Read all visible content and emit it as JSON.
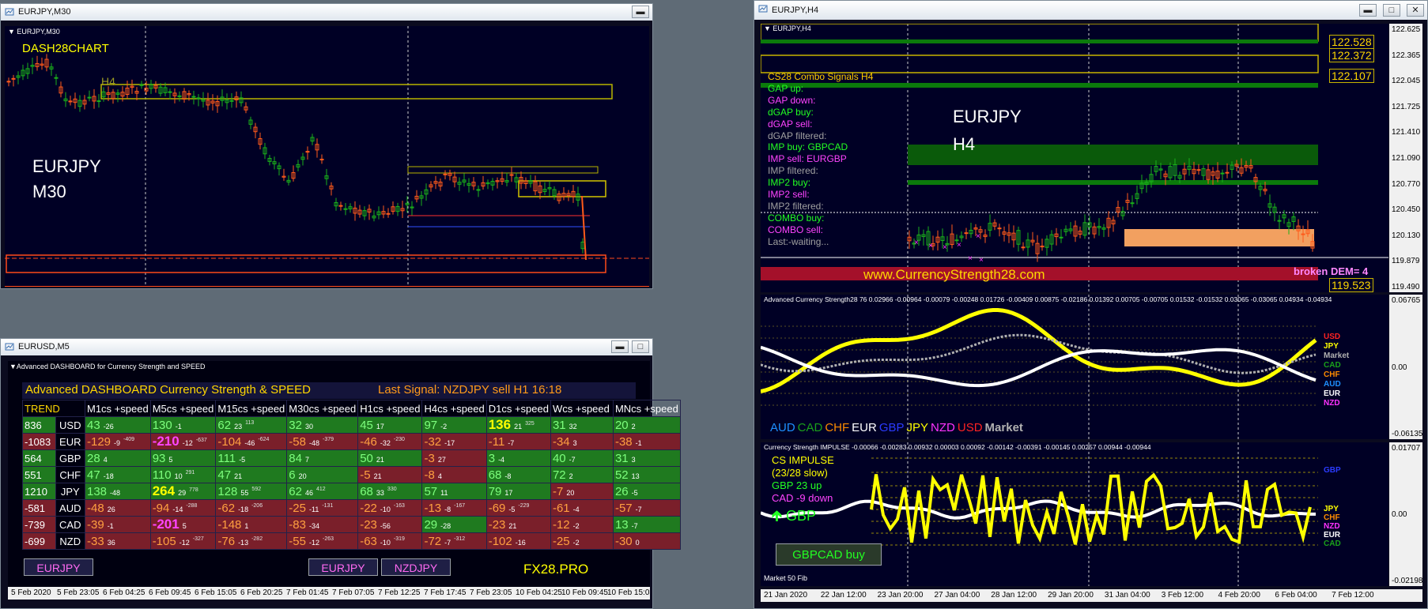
{
  "colors": {
    "bg": "#000025",
    "bull": "#1ab11a",
    "bear": "#ff5a1a",
    "yellow": "#ffff00",
    "magenta": "#ff44ff",
    "green_cell": "#1f8a1f",
    "red_cell": "#8a1f2a"
  },
  "win_eurjpy_m30": {
    "title": "EURJPY,M30",
    "chart_label": "EURJPY,M30",
    "brand": "DASH28CHART",
    "tf_tag": "H4",
    "symbol": "EURJPY",
    "timeframe": "M30"
  },
  "win_eurusd_m5": {
    "title": "EURUSD,M5",
    "chart_label": "Advanced DASHBOARD for Currency Strength and SPEED",
    "header_title": "Advanced  DASHBOARD Currency Strength & SPEED",
    "last_signal": "Last Signal: NZDJPY sell H1 16:18",
    "columns": [
      "TREND",
      "M1cs +speed",
      "M5cs +speed",
      "M15cs +speed",
      "M30cs +speed",
      "H1cs +speed",
      "H4cs +speed",
      "D1cs +speed",
      "Wcs +speed",
      "MNcs +speed"
    ],
    "rows": [
      {
        "trend": "836",
        "cur": "USD",
        "pos": true,
        "cells": [
          [
            "43",
            "-26",
            ""
          ],
          [
            "130",
            "-1",
            ""
          ],
          [
            "62",
            "23",
            "113"
          ],
          [
            "32",
            "30",
            ""
          ],
          [
            "45",
            "17",
            ""
          ],
          [
            "97",
            "-2",
            ""
          ],
          [
            "136",
            "21",
            "325"
          ],
          [
            "31",
            "32",
            ""
          ],
          [
            "20",
            "2",
            ""
          ]
        ]
      },
      {
        "trend": "-1083",
        "cur": "EUR",
        "pos": false,
        "cells": [
          [
            "-129",
            "-9",
            "-409"
          ],
          [
            "-210",
            "-12",
            "-637"
          ],
          [
            "-104",
            "-46",
            "-624"
          ],
          [
            "-58",
            "-48",
            "-379"
          ],
          [
            "-46",
            "-32",
            "-230"
          ],
          [
            "-32",
            "-17",
            ""
          ],
          [
            "-11",
            "-7",
            ""
          ],
          [
            "-34",
            "3",
            ""
          ],
          [
            "-38",
            "-1",
            ""
          ]
        ]
      },
      {
        "trend": "564",
        "cur": "GBP",
        "pos": true,
        "cells": [
          [
            "28",
            "4",
            ""
          ],
          [
            "93",
            "5",
            ""
          ],
          [
            "111",
            "-5",
            ""
          ],
          [
            "84",
            "7",
            ""
          ],
          [
            "50",
            "21",
            ""
          ],
          [
            "-3",
            "27",
            ""
          ],
          [
            "3",
            "-4",
            ""
          ],
          [
            "40",
            "-7",
            ""
          ],
          [
            "31",
            "3",
            ""
          ]
        ]
      },
      {
        "trend": "551",
        "cur": "CHF",
        "pos": true,
        "cells": [
          [
            "47",
            "-18",
            ""
          ],
          [
            "110",
            "10",
            "291"
          ],
          [
            "47",
            "21",
            ""
          ],
          [
            "6",
            "20",
            ""
          ],
          [
            "-5",
            "21",
            ""
          ],
          [
            "-8",
            "4",
            ""
          ],
          [
            "68",
            "-8",
            ""
          ],
          [
            "72",
            "2",
            ""
          ],
          [
            "52",
            "13",
            ""
          ]
        ]
      },
      {
        "trend": "1210",
        "cur": "JPY",
        "pos": true,
        "cells": [
          [
            "138",
            "-48",
            ""
          ],
          [
            "264",
            "29",
            "778"
          ],
          [
            "128",
            "55",
            "592"
          ],
          [
            "62",
            "46",
            "412"
          ],
          [
            "68",
            "33",
            "330"
          ],
          [
            "57",
            "11",
            ""
          ],
          [
            "79",
            "17",
            ""
          ],
          [
            "-7",
            "20",
            ""
          ],
          [
            "26",
            "-5",
            ""
          ]
        ]
      },
      {
        "trend": "-581",
        "cur": "AUD",
        "pos": false,
        "cells": [
          [
            "-48",
            "26",
            ""
          ],
          [
            "-94",
            "-14",
            "-288"
          ],
          [
            "-62",
            "-18",
            "-206"
          ],
          [
            "-25",
            "-11",
            "-131"
          ],
          [
            "-22",
            "-10",
            "-163"
          ],
          [
            "-13",
            "-8",
            "-167"
          ],
          [
            "-69",
            "-5",
            "-229"
          ],
          [
            "-61",
            "-4",
            ""
          ],
          [
            "-57",
            "-7",
            ""
          ]
        ]
      },
      {
        "trend": "-739",
        "cur": "CAD",
        "pos": false,
        "cells": [
          [
            "-39",
            "-1",
            ""
          ],
          [
            "-201",
            "5",
            ""
          ],
          [
            "-148",
            "1",
            ""
          ],
          [
            "-83",
            "-34",
            ""
          ],
          [
            "-23",
            "-56",
            ""
          ],
          [
            "29",
            "-28",
            ""
          ],
          [
            "-23",
            "21",
            ""
          ],
          [
            "-12",
            "-2",
            ""
          ],
          [
            "13",
            "-7",
            ""
          ]
        ]
      },
      {
        "trend": "-699",
        "cur": "NZD",
        "pos": false,
        "cells": [
          [
            "-33",
            "36",
            ""
          ],
          [
            "-105",
            "-12",
            "-327"
          ],
          [
            "-76",
            "-13",
            "-282"
          ],
          [
            "-55",
            "-12",
            "-263"
          ],
          [
            "-63",
            "-10",
            "-319"
          ],
          [
            "-72",
            "-7",
            "-312"
          ],
          [
            "-102",
            "-16",
            ""
          ],
          [
            "-25",
            "-2",
            ""
          ],
          [
            "-30",
            "0",
            ""
          ]
        ]
      }
    ],
    "buttons": [
      "EURJPY",
      "EURJPY",
      "NZDJPY"
    ],
    "fx_label": "FX28.PRO",
    "time_axis": [
      "5 Feb 2020",
      "5 Feb 23:05",
      "6 Feb 04:25",
      "6 Feb 09:45",
      "6 Feb 15:05",
      "6 Feb 20:25",
      "7 Feb 01:45",
      "7 Feb 07:05",
      "7 Feb 12:25",
      "7 Feb 17:45",
      "7 Feb 23:05",
      "10 Feb 04:25",
      "10 Feb 09:45",
      "10 Feb 15:05"
    ]
  },
  "win_eurjpy_h4": {
    "title": "EURJPY,H4",
    "chart_label": "EURJPY,H4",
    "symbol": "EURJPY",
    "timeframe": "H4",
    "signals": [
      {
        "text": "CS28 Combo Signals  H4",
        "color": "#ffcc00"
      },
      {
        "text": "GAP up:",
        "color": "#22ff22"
      },
      {
        "text": "GAP down:",
        "color": "#ff44ff"
      },
      {
        "text": "dGAP buy:",
        "color": "#22ff22"
      },
      {
        "text": "dGAP sell:",
        "color": "#ff44ff"
      },
      {
        "text": "dGAP filtered:",
        "color": "#a0a0a0"
      },
      {
        "text": "IMP buy: GBPCAD",
        "color": "#22ff22"
      },
      {
        "text": "IMP sell: EURGBP",
        "color": "#ff44ff"
      },
      {
        "text": "IMP filtered:",
        "color": "#a0a0a0"
      },
      {
        "text": "IMP2 buy:",
        "color": "#22ff22"
      },
      {
        "text": "IMP2 sell:",
        "color": "#ff44ff"
      },
      {
        "text": "IMP2 filtered:",
        "color": "#a0a0a0"
      },
      {
        "text": "COMBO buy:",
        "color": "#22ff22"
      },
      {
        "text": "COMBO sell:",
        "color": "#ff44ff"
      },
      {
        "text": "Last:-waiting...",
        "color": "#a0a0a0"
      }
    ],
    "website": "www.CurrencyStrength28.com",
    "broken_dem": "broken DEM= 4",
    "level_labels": [
      "122.528",
      "122.372",
      "122.107",
      "119.523"
    ],
    "price_axis": [
      "122.625",
      "122.365",
      "122.045",
      "121.725",
      "121.410",
      "121.090",
      "120.770",
      "120.450",
      "120.130",
      "119.879",
      "119.490"
    ],
    "price_current": "119.879",
    "strength_title": "Advanced Currency Strength28 76 0.02966 -0.00964 -0.00079 -0.00248 0.01726 -0.00409 0.00875 -0.02186 0.01392 0.00705 -0.00705 0.01532 -0.01532 0.03065 -0.03065 0.04934 -0.04934",
    "strength_axis": [
      "0.06765",
      "0.00",
      "-0.06135"
    ],
    "strength_legend": [
      {
        "name": "AUD",
        "color": "#1e90ff"
      },
      {
        "name": "CAD",
        "color": "#1aa11a"
      },
      {
        "name": "CHF",
        "color": "#ff8c00"
      },
      {
        "name": "EUR",
        "color": "#ffffff"
      },
      {
        "name": "GBP",
        "color": "#2b3bff"
      },
      {
        "name": "JPY",
        "color": "#ffff00"
      },
      {
        "name": "NZD",
        "color": "#ff33ff"
      },
      {
        "name": "USD",
        "color": "#ff2222"
      },
      {
        "name": "Market",
        "color": "#b0b0b0"
      }
    ],
    "strength_right": [
      {
        "name": "USD",
        "color": "#ff2222"
      },
      {
        "name": "JPY",
        "color": "#ffff00"
      },
      {
        "name": "Market",
        "color": "#b0b0b0"
      },
      {
        "name": "CAD",
        "color": "#1aa11a"
      },
      {
        "name": "CHF",
        "color": "#ff8c00"
      },
      {
        "name": "AUD",
        "color": "#1e90ff"
      },
      {
        "name": "EUR",
        "color": "#ffffff"
      },
      {
        "name": "NZD",
        "color": "#ff33ff"
      }
    ],
    "impulse_title": "Currency Strength IMPULSE -0.00066 -0.00283 0.00932 0.00003 0.00092 -0.00142 -0.00391 -0.00145 0.00257 0.00944 -0.00944",
    "impulse_info": [
      {
        "text": "CS IMPULSE",
        "color": "#ffff00"
      },
      {
        "text": "(23/28 slow)",
        "color": "#ffff00"
      },
      {
        "text": "GBP 23 up",
        "color": "#22ff22"
      },
      {
        "text": "CAD -9 down",
        "color": "#ff44ff"
      }
    ],
    "impulse_arrow": "GBP",
    "impulse_button": "GBPCAD buy",
    "impulse_footer": "Market 50 Fib",
    "impulse_axis": [
      "0.01707",
      "0.00",
      "-0.02198"
    ],
    "impulse_right": [
      {
        "name": "GBP",
        "color": "#2b3bff"
      },
      {
        "name": "JPY",
        "color": "#ffff00"
      },
      {
        "name": "CHF",
        "color": "#ff8c00"
      },
      {
        "name": "NZD",
        "color": "#ff33ff"
      },
      {
        "name": "EUR",
        "color": "#ffffff"
      },
      {
        "name": "CAD",
        "color": "#1aa11a"
      }
    ],
    "time_axis": [
      "21 Jan 2020",
      "22 Jan 12:00",
      "23 Jan 20:00",
      "27 Jan 04:00",
      "28 Jan 12:00",
      "29 Jan 20:00",
      "31 Jan 04:00",
      "3 Feb 12:00",
      "4 Feb 20:00",
      "6 Feb 04:00",
      "7 Feb 12:00"
    ]
  }
}
